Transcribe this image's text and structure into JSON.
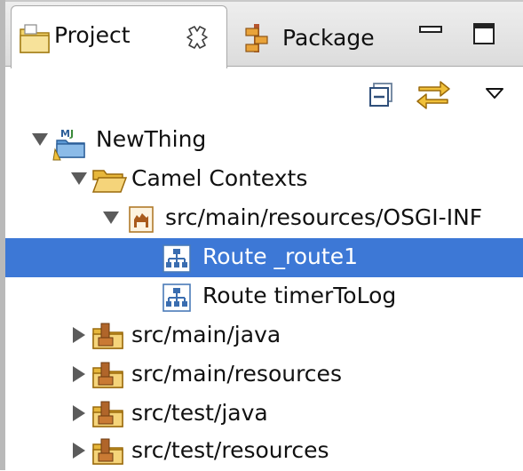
{
  "tabs": {
    "project": {
      "label": "Project"
    },
    "package": {
      "label": "Package"
    }
  },
  "tree": {
    "project": {
      "label": "NewThing"
    },
    "camel_contexts": {
      "label": "Camel Contexts"
    },
    "context_file": {
      "label": "src/main/resources/OSGI-INF"
    },
    "route_1": {
      "label": "Route _route1",
      "selected": true
    },
    "route_2": {
      "label": "Route timerToLog"
    },
    "src_main_java": {
      "label": "src/main/java"
    },
    "src_main_resources": {
      "label": "src/main/resources"
    },
    "src_test_java": {
      "label": "src/test/java"
    },
    "src_test_resources": {
      "label": "src/test/resources"
    }
  },
  "colors": {
    "selection": "#3d78d6",
    "folder": "#e7b73b"
  }
}
